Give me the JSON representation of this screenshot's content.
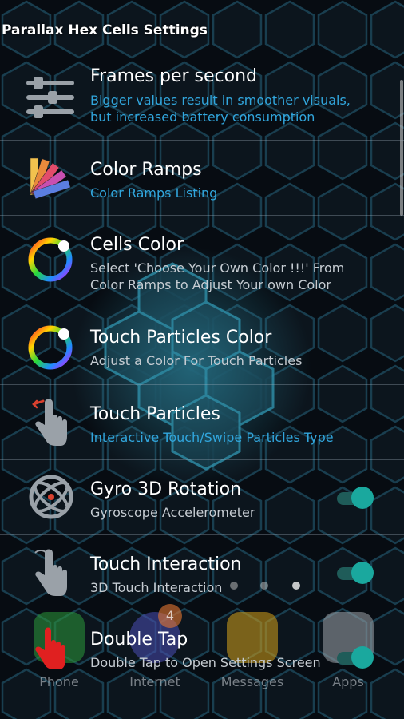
{
  "header": {
    "title": "Parallax Hex Cells Settings"
  },
  "colors": {
    "blue_sub": "#31a6dd",
    "grey_sub": "#c6ccd2",
    "toggle_on": "#1aa89e"
  },
  "settings": [
    {
      "title": "Frames per second",
      "subtitle": "Bigger values result in smoother visuals, but increased battery consumption",
      "icon": "sliders-icon"
    },
    {
      "title": "Color Ramps",
      "subtitle": "Color Ramps Listing",
      "icon": "color-swatch-icon"
    },
    {
      "title": "Cells Color",
      "subtitle": "Select 'Choose Your Own Color !!!' From Color Ramps to Adjust Your own Color",
      "icon": "color-wheel-icon"
    },
    {
      "title": "Touch Particles Color",
      "subtitle": "Adjust a Color For Touch Particles",
      "icon": "color-wheel-icon"
    },
    {
      "title": "Touch Particles",
      "subtitle": "Interactive Touch/Swipe Particles Type",
      "icon": "hand-touch-icon"
    },
    {
      "title": "Gyro 3D Rotation",
      "subtitle": "Gyroscope Accelerometer",
      "icon": "gyroscope-icon",
      "toggle": true
    },
    {
      "title": "Touch Interaction",
      "subtitle": "3D Touch Interaction",
      "icon": "hand-touch-icon",
      "toggle": true
    },
    {
      "title": "Double Tap",
      "subtitle": "Double Tap to Open Settings Screen",
      "icon": "double-tap-icon",
      "toggle": true
    }
  ],
  "dock": [
    {
      "label": "Phone",
      "icon": "phone-icon"
    },
    {
      "label": "Internet",
      "icon": "internet-icon",
      "badge": "4"
    },
    {
      "label": "Messages",
      "icon": "messages-icon"
    },
    {
      "label": "Apps",
      "icon": "apps-grid-icon"
    }
  ]
}
